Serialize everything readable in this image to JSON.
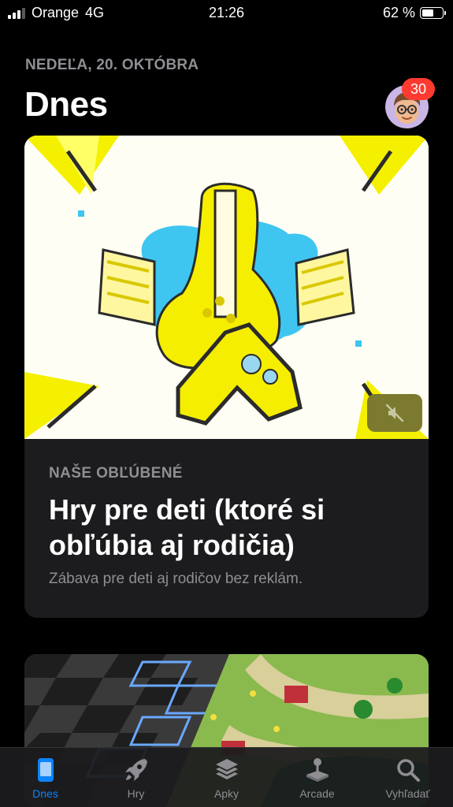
{
  "status_bar": {
    "carrier": "Orange",
    "network": "4G",
    "time": "21:26",
    "battery": "62 %",
    "battery_level": 0.62
  },
  "header": {
    "date": "NEDEĽA, 20. OKTÓBRA",
    "title": "Dnes",
    "avatar_icon": "memoji-avatar",
    "badge_count": "30"
  },
  "featured_card": {
    "eyebrow": "NAŠE OBĽÚBENÉ",
    "title": "Hry pre deti (ktoré si obľúbia aj rodičia)",
    "subtitle": "Zábava pre deti aj rodičov bez reklám.",
    "mute_icon": "speaker-muted-icon"
  },
  "tab_bar": {
    "items": [
      {
        "label": "Dnes",
        "icon": "today-icon",
        "active": true
      },
      {
        "label": "Hry",
        "icon": "rocket-icon",
        "active": false
      },
      {
        "label": "Apky",
        "icon": "layers-icon",
        "active": false
      },
      {
        "label": "Arcade",
        "icon": "joystick-icon",
        "active": false
      },
      {
        "label": "Vyhľadať",
        "icon": "search-icon",
        "active": false
      }
    ]
  },
  "colors": {
    "accent": "#0a84ff",
    "badge": "#ff3b30",
    "secondary_text": "#8e8e93",
    "card_bg": "#1c1c1e"
  }
}
